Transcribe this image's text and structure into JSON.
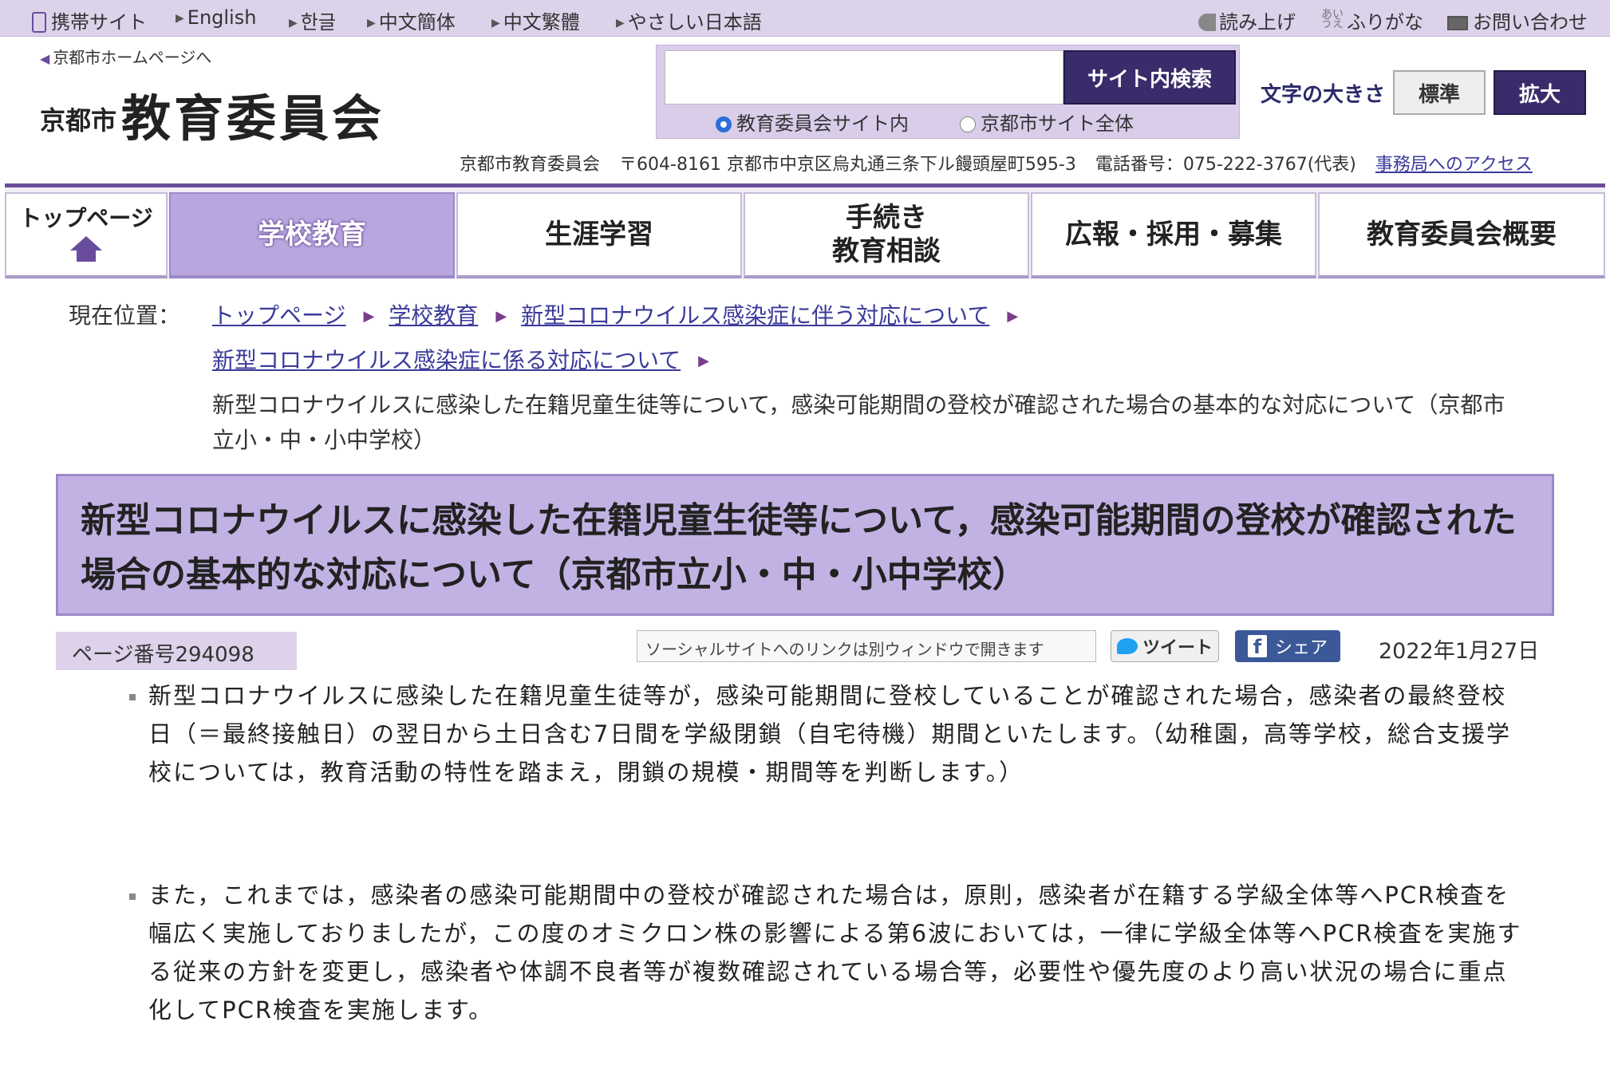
{
  "topbar": {
    "links": [
      "携帯サイト",
      "English",
      "한글",
      "中文簡体",
      "中文繁體",
      "やさしい日本語"
    ],
    "read_aloud": "読み上げ",
    "furigana": "ふりがな",
    "contact": "お問い合わせ"
  },
  "header": {
    "home_link": "京都市ホームページへ",
    "logo_city": "京都市",
    "logo_board": "教育委員会",
    "search_button": "サイト内検索",
    "search_value": "",
    "radio_board": "教育委員会サイト内",
    "radio_city": "京都市サイト全体",
    "fontsize_label": "文字の大きさ",
    "fontsize_normal": "標準",
    "fontsize_large": "拡大",
    "address_org": "京都市教育委員会",
    "address_postal": "〒604-8161 京都市中京区烏丸通三条下ル饅頭屋町595-3",
    "address_phone": "電話番号：075-222-3767(代表)",
    "access_link": "事務局へのアクセス"
  },
  "nav": {
    "top": "トップページ",
    "school": "学校教育",
    "lifelong": "生涯学習",
    "procedures_line1": "手続き",
    "procedures_line2": "教育相談",
    "pr": "広報・採用・募集",
    "overview": "教育委員会概要"
  },
  "breadcrumb": {
    "label": "現在位置：",
    "items": [
      "トップページ",
      "学校教育",
      "新型コロナウイルス感染症に伴う対応について",
      "新型コロナウイルス感染症に係る対応について"
    ],
    "current": "新型コロナウイルスに感染した在籍児童生徒等について，感染可能期間の登校が確認された場合の基本的な対応について（京都市立小・中・小中学校）"
  },
  "page": {
    "title": "新型コロナウイルスに感染した在籍児童生徒等について，感染可能期間の登校が確認された場合の基本的な対応について（京都市立小・中・小中学校）",
    "page_number": "ページ番号294098",
    "social_note": "ソーシャルサイトへのリンクは別ウィンドウで開きます",
    "tweet": "ツイート",
    "share": "シェア",
    "date": "2022年1月27日"
  },
  "body": {
    "para1": "新型コロナウイルスに感染した在籍児童生徒等が，感染可能期間に登校していることが確認された場合，感染者の最終登校日（＝最終接触日）の翌日から土日含む7日間を学級閉鎖（自宅待機）期間といたします。（幼稚園，高等学校，総合支援学校については，教育活動の特性を踏まえ，閉鎖の規模・期間等を判断します。）",
    "para2": "また，これまでは，感染者の感染可能期間中の登校が確認された場合は，原則，感染者が在籍する学級全体等へPCR検査を幅広く実施しておりましたが，この度のオミクロン株の影響による第6波においては，一律に学級全体等へPCR検査を実施する従来の方針を変更し，感染者や体調不良者等が複数確認されている場合等，必要性や優先度のより高い状況の場合に重点化してPCR検査を実施します。"
  },
  "colors": {
    "accent": "#6a4c9c",
    "title_bg": "#c2b2e4",
    "nav_active": "#b9a6de",
    "search_button": "#3a2c6a"
  }
}
